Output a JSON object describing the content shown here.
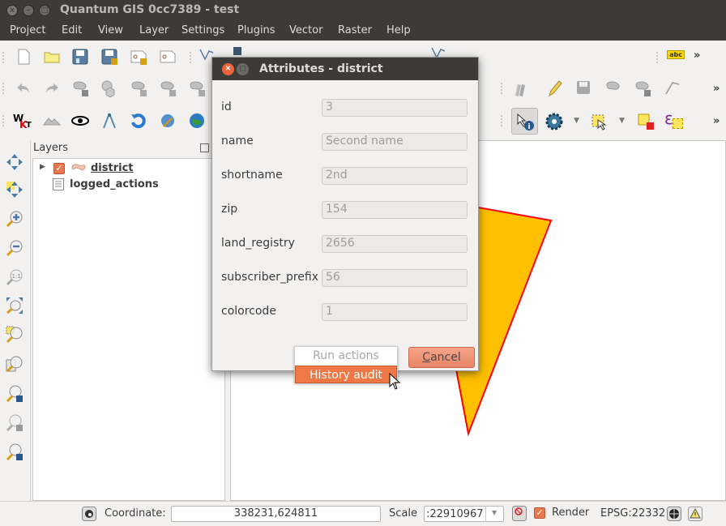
{
  "window": {
    "title": "Quantum GIS 0cc7389 - test",
    "close_glyph": "×",
    "min_glyph": "–",
    "max_glyph": "□"
  },
  "menu": [
    {
      "label": "Project"
    },
    {
      "label": "Edit"
    },
    {
      "label": "View"
    },
    {
      "label": "Layer"
    },
    {
      "label": "Settings"
    },
    {
      "label": "Plugins"
    },
    {
      "label": "Vector"
    },
    {
      "label": "Raster"
    },
    {
      "label": "Help"
    }
  ],
  "toolbar": {
    "overflow_glyph": "»",
    "label_icon_text": "abc",
    "wkt_text": "WKT"
  },
  "layers_panel": {
    "title": "Layers",
    "layers": [
      {
        "name": "district",
        "checked": true,
        "type": "polygon",
        "expanded": false
      },
      {
        "name": "logged_actions",
        "type": "table"
      }
    ]
  },
  "dialog": {
    "title": "Attributes - district",
    "fields": [
      {
        "label": "id",
        "value": "3"
      },
      {
        "label": "name",
        "value": "Second name"
      },
      {
        "label": "shortname",
        "value": "2nd"
      },
      {
        "label": "zip",
        "value": "154"
      },
      {
        "label": "land_registry",
        "value": "2656"
      },
      {
        "label": "subscriber_prefix",
        "value": "56"
      },
      {
        "label": "colorcode",
        "value": "1"
      }
    ],
    "cancel_label": "Cancel",
    "popup_menu": [
      {
        "label": "Run actions",
        "enabled": false
      },
      {
        "label": "History audit",
        "highlighted": true
      }
    ]
  },
  "map": {
    "feature_fill": "#ffc000",
    "feature_stroke": "#ff0000"
  },
  "statusbar": {
    "coordinate_label": "Coordinate:",
    "coordinate_value": "338231,624811",
    "scale_label": "Scale",
    "scale_value": ":22910967",
    "render_label": "Render",
    "render_checked": true,
    "crs": "EPSG:22332"
  },
  "colors": {
    "accent": "#e9784f",
    "titlebar": "#3c3b37",
    "highlight": "#f07746"
  }
}
